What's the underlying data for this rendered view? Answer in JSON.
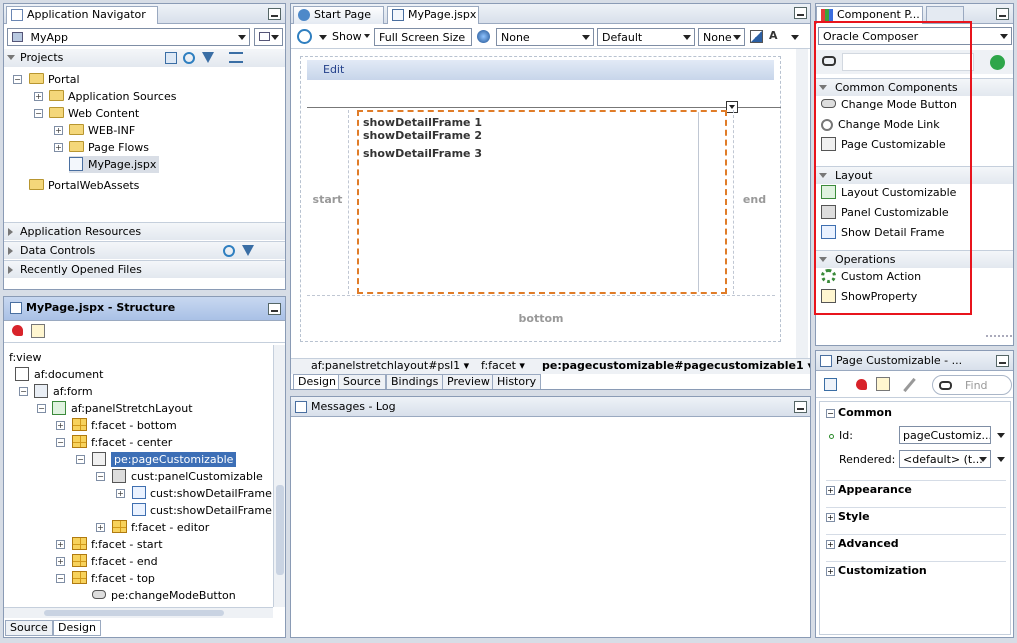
{
  "navigator": {
    "tab_title": "Application Navigator",
    "app_combo": "MyApp",
    "projects_label": "Projects",
    "tree": [
      {
        "label": "Portal"
      },
      {
        "label": "Application Sources"
      },
      {
        "label": "Web Content"
      },
      {
        "label": "WEB-INF"
      },
      {
        "label": "Page Flows"
      },
      {
        "label": "MyPage.jspx"
      },
      {
        "label": "PortalWebAssets"
      }
    ],
    "sections": [
      "Application Resources",
      "Data Controls",
      "Recently Opened Files"
    ]
  },
  "structure": {
    "tab_title": "MyPage.jspx - Structure",
    "tree": [
      {
        "label": "f:view"
      },
      {
        "label": "af:document"
      },
      {
        "label": "af:form"
      },
      {
        "label": "af:panelStretchLayout"
      },
      {
        "label": "f:facet - bottom"
      },
      {
        "label": "f:facet - center"
      },
      {
        "label": "pe:pageCustomizable"
      },
      {
        "label": "cust:panelCustomizable"
      },
      {
        "label": "cust:showDetailFrame"
      },
      {
        "label": "cust:showDetailFrame"
      },
      {
        "label": "f:facet - editor"
      },
      {
        "label": "f:facet - start"
      },
      {
        "label": "f:facet - end"
      },
      {
        "label": "f:facet - top"
      },
      {
        "label": "pe:changeModeButton"
      }
    ],
    "bottom_tabs": [
      "Source",
      "Design"
    ]
  },
  "editor": {
    "tabs": [
      "Start Page",
      "MyPage.jspx"
    ],
    "toolbar": {
      "show_label": "Show",
      "size_combo": "Full Screen Size",
      "combo_none1": "None",
      "combo_default": "Default",
      "combo_none2": "None"
    },
    "canvas": {
      "edit_label": "Edit",
      "frames": [
        "showDetailFrame 1",
        "showDetailFrame 2",
        "showDetailFrame 3"
      ],
      "start_label": "start",
      "end_label": "end",
      "bottom_label": "bottom"
    },
    "breadcrumb": [
      "af:panelstretchlayout#psl1",
      "f:facet",
      "pe:pagecustomizable#pagecustomizable1"
    ],
    "bottom_tabs": [
      "Design",
      "Source",
      "Bindings",
      "Preview",
      "History"
    ]
  },
  "messages": {
    "tab_title": "Messages - Log"
  },
  "palette": {
    "tab_title": "Component P...",
    "combo": "Oracle Composer",
    "groups": [
      {
        "title": "Common Components",
        "items": [
          "Change Mode Button",
          "Change Mode Link",
          "Page Customizable"
        ]
      },
      {
        "title": "Layout",
        "items": [
          "Layout Customizable",
          "Panel Customizable",
          "Show Detail Frame"
        ]
      },
      {
        "title": "Operations",
        "items": [
          "Custom Action",
          "ShowProperty"
        ]
      }
    ],
    "highlight_color": "#e8141c"
  },
  "inspector": {
    "tab_title": "Page Customizable - ...",
    "find_placeholder": "Find",
    "common_label": "Common",
    "id_label": "Id:",
    "id_value": "pageCustomiz...",
    "rendered_label": "Rendered:",
    "rendered_value": "<default> (t...",
    "sections": [
      "Appearance",
      "Style",
      "Advanced",
      "Customization"
    ]
  }
}
